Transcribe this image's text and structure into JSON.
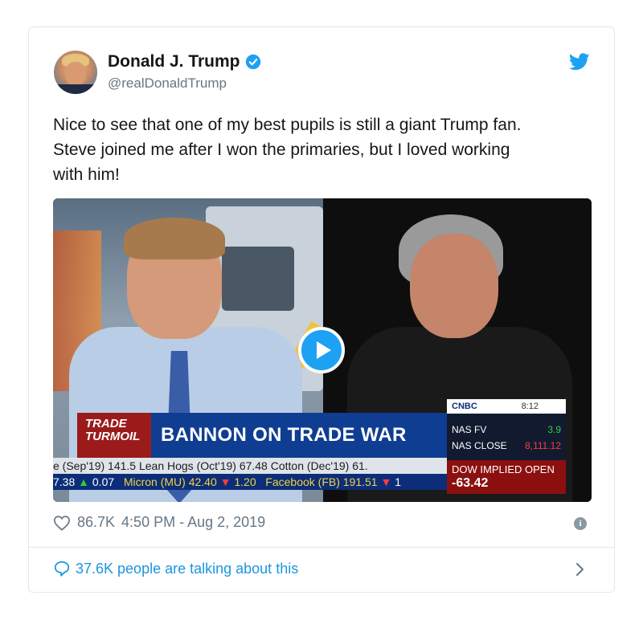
{
  "author": {
    "name": "Donald J. Trump",
    "handle": "@realDonaldTrump"
  },
  "tweet": {
    "text_line1": "Nice to see that one of my best pupils is still a giant Trump fan.",
    "text_line2": "Steve joined me after I won the primaries, but I loved working",
    "text_line3": "with him!"
  },
  "media": {
    "banner_label_line1": "TRADE",
    "banner_label_line2": "TURMOIL",
    "headline": "BANNON ON TRADE WAR",
    "ticker_row1": "e (Sep'19) 141.5    Lean Hogs (Oct'19) 67.48    Cotton (Dec'19) 61.",
    "ticker_row2_a": "7.38",
    "ticker_row2_b": "0.07",
    "ticker_row2_c": "Micron (MU) 42.40",
    "ticker_row2_d": "1.20",
    "ticker_row2_e": "Facebook (FB) 191.51",
    "ticker_row2_f": "1",
    "cnbc_logo": "CNBC",
    "cnbc_time": "8:12",
    "nas_fv_label": "NAS FV",
    "nas_fv_value": "3.9",
    "nas_close_label": "NAS CLOSE",
    "nas_close_value": "8,111.12",
    "dow_label": "DOW IMPLIED OPEN",
    "dow_value": "-63.42"
  },
  "footer": {
    "likes": "86.7K",
    "timestamp": "4:50 PM - Aug 2, 2019",
    "talking": "37.6K people are talking about this"
  },
  "colors": {
    "twitter_blue": "#1da1f2",
    "link_blue": "#1b95e0",
    "meta_gray": "#657786"
  }
}
